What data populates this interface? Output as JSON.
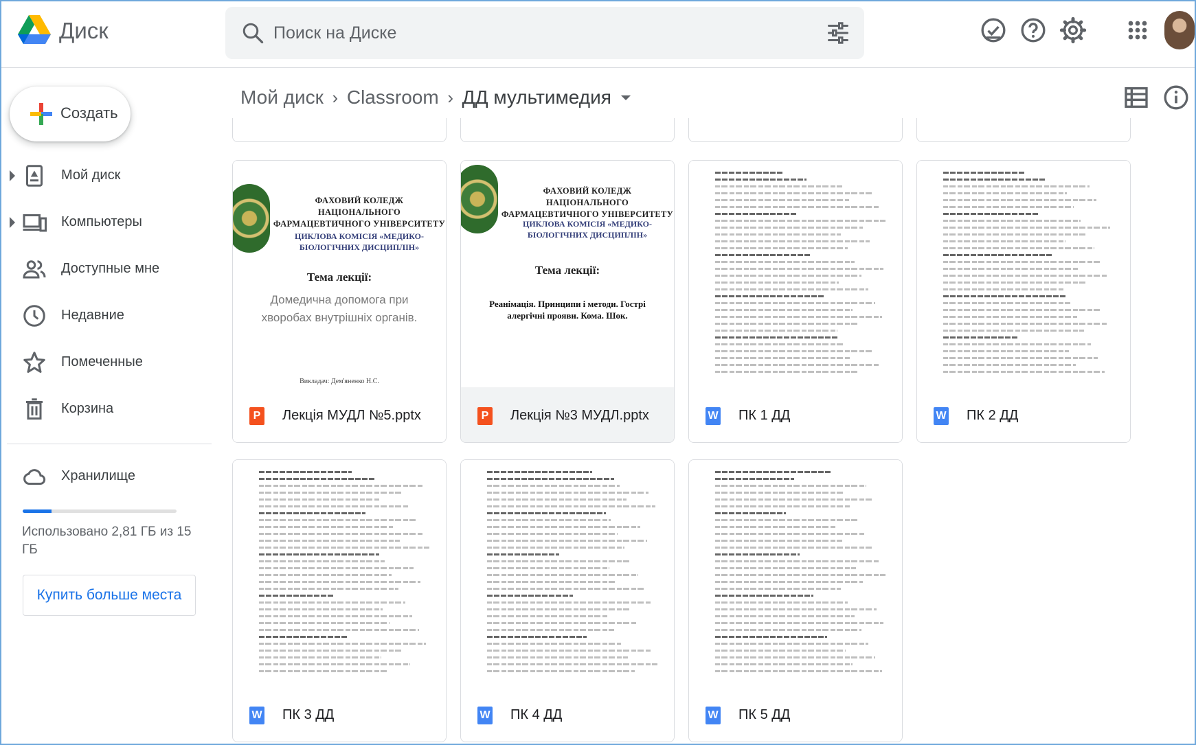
{
  "app": {
    "title": "Диск"
  },
  "search": {
    "placeholder": "Поиск на Диске"
  },
  "sidebar": {
    "create_label": "Создать",
    "items": [
      {
        "label": "Мой диск",
        "icon": "my-drive-icon"
      },
      {
        "label": "Компьютеры",
        "icon": "computers-icon"
      },
      {
        "label": "Доступные мне",
        "icon": "shared-with-me-icon"
      },
      {
        "label": "Недавние",
        "icon": "recent-clock-icon"
      },
      {
        "label": "Помеченные",
        "icon": "star-icon"
      },
      {
        "label": "Корзина",
        "icon": "trash-icon"
      }
    ],
    "storage": {
      "label": "Хранилище",
      "used_text": "Использовано 2,81 ГБ из 15 ГБ",
      "used_fraction": 0.187,
      "buy_label": "Купить больше места"
    }
  },
  "breadcrumb": {
    "root": "Мой диск",
    "middle": "Classroom",
    "current": "ДД мультимедия"
  },
  "files": [
    {
      "name": "Лекція МУДЛ №5.pptx",
      "type": "P",
      "kind": "slides",
      "selected": false,
      "thumb": {
        "college": "ФАХОВИЙ КОЛЕДЖ НАЦІОНАЛЬНОГО ФАРМАЦЕВТИЧНОГО УНІВЕРСИТЕТУ",
        "commission": "ЦИКЛОВА КОМІСІЯ «МЕДИКО-БІОЛОГІЧНИХ ДИСЦИПЛІН»",
        "theme": "Тема лекції:",
        "lecture": "Домедична допомога при хворобах внутрішніх органів.",
        "author": "Викладач: Дем'яненко Н.С."
      }
    },
    {
      "name": "Лекція №3 МУДЛ.pptx",
      "type": "P",
      "kind": "slides",
      "selected": true,
      "thumb": {
        "college": "ФАХОВИЙ КОЛЕДЖ НАЦІОНАЛЬНОГО ФАРМАЦЕВТИЧНОГО УНІВЕРСИТЕТУ",
        "commission": "ЦИКЛОВА КОМІСІЯ «МЕДИКО-БІОЛОГІЧНИХ ДИСЦИПЛІН»",
        "theme": "Тема лекції:",
        "lecture": "Реанімація. Принципи і методи. Гострі алергічні прояви. Кома. Шок."
      }
    },
    {
      "name": "ПК 1 ДД",
      "type": "W",
      "kind": "doc",
      "selected": false
    },
    {
      "name": "ПК 2 ДД",
      "type": "W",
      "kind": "doc",
      "selected": false
    },
    {
      "name": "ПК 3 ДД",
      "type": "W",
      "kind": "doc",
      "selected": false
    },
    {
      "name": "ПК 4 ДД",
      "type": "W",
      "kind": "doc",
      "selected": false
    },
    {
      "name": "ПК 5 ДД",
      "type": "W",
      "kind": "doc",
      "selected": false
    }
  ],
  "colors": {
    "accent": "#1a73e8",
    "slides": "#f4511e",
    "docs": "#4285f4",
    "border": "#dadce0"
  }
}
